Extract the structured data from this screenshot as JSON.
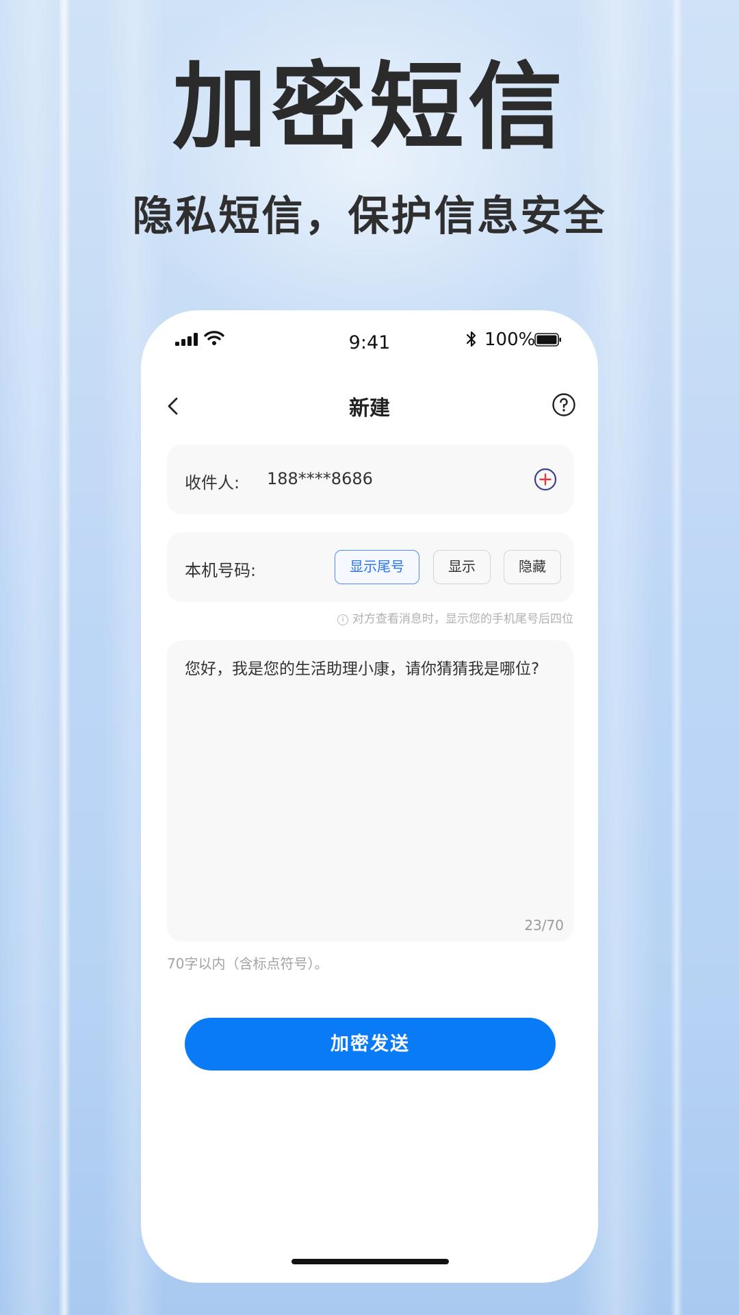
{
  "hero": {
    "title": "加密短信",
    "subtitle": "隐私短信，保护信息安全"
  },
  "status_bar": {
    "time": "9:41",
    "battery": "100%",
    "icons": [
      "signal-icon",
      "wifi-icon",
      "bluetooth-icon",
      "battery-icon"
    ]
  },
  "nav": {
    "title": "新建",
    "back_icon": "chevron-left-icon",
    "help_icon": "help-circle-icon"
  },
  "recipient": {
    "label": "收件人:",
    "value": "188****8686",
    "add_icon": "add-circle-icon"
  },
  "own_number": {
    "label": "本机号码:",
    "options": [
      "显示尾号",
      "显示",
      "隐藏"
    ],
    "selected": "显示尾号",
    "hint": "对方查看消息时，显示您的手机尾号后四位"
  },
  "message": {
    "text": "您好，我是您的生活助理小康，请你猜猜我是哪位?",
    "counter": "23/70",
    "limit_note": "70字以内（含标点符号）。"
  },
  "send_button": {
    "label": "加密发送"
  },
  "colors": {
    "accent": "#0a7bf7",
    "selected_option": "#2b74ef",
    "add_icon": "#3a3f8f",
    "add_icon_plus": "#e0383c"
  }
}
